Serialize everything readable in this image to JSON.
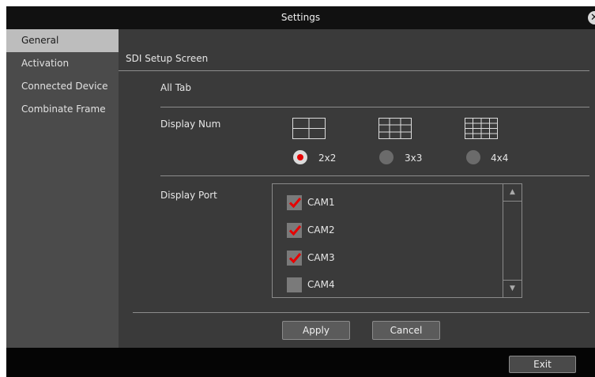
{
  "window": {
    "title": "Settings"
  },
  "sidebar": {
    "items": [
      {
        "label": "General",
        "active": true
      },
      {
        "label": "Activation",
        "active": false
      },
      {
        "label": "Connected Device",
        "active": false
      },
      {
        "label": "Combinate Frame",
        "active": false
      }
    ]
  },
  "main": {
    "section_title": "SDI Setup Screen",
    "all_tab_label": "All Tab",
    "display_num": {
      "label": "Display Num",
      "options": [
        {
          "label": "2x2",
          "selected": true
        },
        {
          "label": "3x3",
          "selected": false
        },
        {
          "label": "4x4",
          "selected": false
        }
      ]
    },
    "display_port": {
      "label": "Display Port",
      "cameras": [
        {
          "label": "CAM1",
          "checked": true
        },
        {
          "label": "CAM2",
          "checked": true
        },
        {
          "label": "CAM3",
          "checked": true
        },
        {
          "label": "CAM4",
          "checked": false
        }
      ]
    },
    "buttons": {
      "apply": "Apply",
      "cancel": "Cancel"
    }
  },
  "footer": {
    "exit": "Exit"
  },
  "icons": {
    "close": "close-icon",
    "grid_2x2": "grid-2x2-icon",
    "grid_3x3": "grid-3x3-icon",
    "grid_4x4": "grid-4x4-icon",
    "check": "checkmark-icon",
    "scroll_up": "scroll-up-arrow-icon",
    "scroll_down": "scroll-down-arrow-icon"
  },
  "colors": {
    "accent_red": "#e60000",
    "sidebar_active": "#bdbdbd"
  }
}
